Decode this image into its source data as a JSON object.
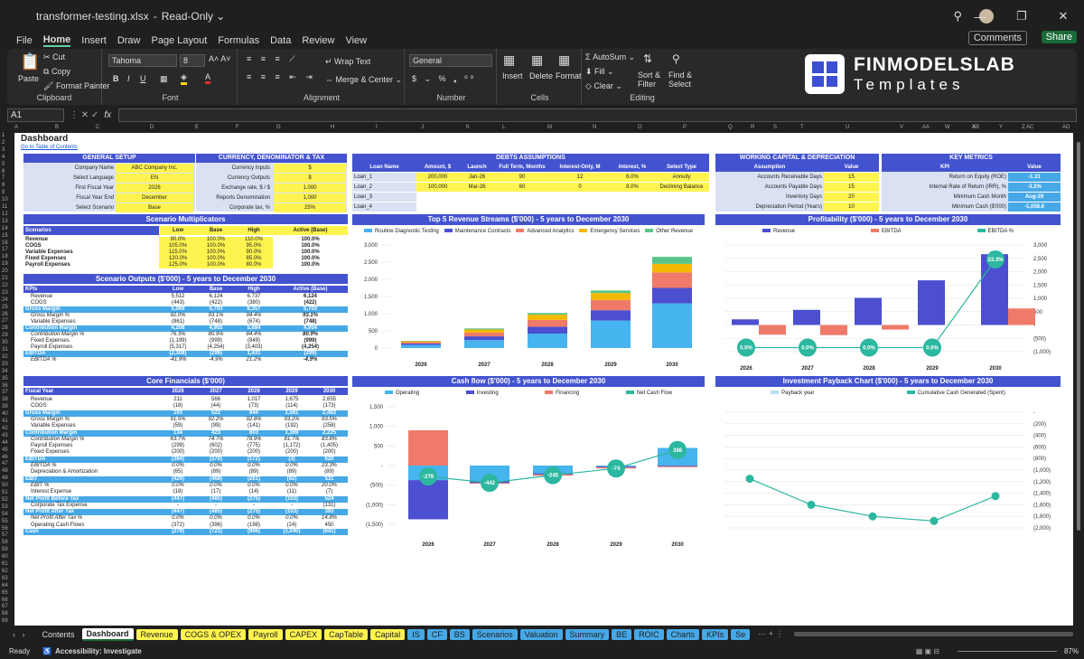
{
  "window": {
    "title": "transformer-testing.xlsx",
    "mode": "Read-Only"
  },
  "menu": [
    "File",
    "Home",
    "Insert",
    "Draw",
    "Page Layout",
    "Formulas",
    "Data",
    "Review",
    "View"
  ],
  "header_buttons": {
    "comments": "Comments",
    "share": "Share"
  },
  "ribbon": {
    "clipboard": {
      "paste": "Paste",
      "cut": "Cut",
      "copy": "Copy",
      "format_painter": "Format Painter",
      "label": "Clipboard"
    },
    "font": {
      "name": "Tahoma",
      "size": "8",
      "label": "Font"
    },
    "alignment": {
      "wrap": "Wrap Text",
      "merge": "Merge & Center",
      "label": "Alignment"
    },
    "number": {
      "format": "General",
      "label": "Number"
    },
    "cells": {
      "insert": "Insert",
      "delete": "Delete",
      "format": "Format",
      "label": "Cells"
    },
    "editing": {
      "autosum": "AutoSum",
      "fill": "Fill",
      "clear": "Clear",
      "sort": "Sort & Filter",
      "find": "Find & Select",
      "label": "Editing"
    },
    "logo": {
      "line1": "FINMODELSLAB",
      "line2": "Templates"
    }
  },
  "formula_bar": {
    "cell": "A1",
    "fx": "fx"
  },
  "columns": [
    "A",
    "B",
    "C",
    "D",
    "E",
    "F",
    "G",
    "H",
    "I",
    "J",
    "K",
    "L",
    "M",
    "N",
    "O",
    "P",
    "Q",
    "R",
    "S",
    "T",
    "U",
    "V",
    "W",
    "X",
    "Y",
    "Z",
    "AA",
    "AB",
    "AC",
    "AD"
  ],
  "dashboard": {
    "title": "Dashboard",
    "toc": "Go to Table of Contents",
    "general": {
      "title": "GENERAL SETUP",
      "rows": [
        [
          "Company Name",
          "ABC Company Inc."
        ],
        [
          "Select Language",
          "EN"
        ],
        [
          "First Fiscal Year",
          "2026"
        ],
        [
          "Fiscal Year End",
          "December"
        ],
        [
          "Select Scenario",
          "Base"
        ]
      ]
    },
    "currency": {
      "title": "CURRENCY, DENOMINATOR & TAX",
      "rows": [
        [
          "Currency Inputs",
          "$"
        ],
        [
          "Currency Outputs",
          "$"
        ],
        [
          "Exchange rate, $ / $",
          "1.000"
        ],
        [
          "Reports Denomination",
          "1,000"
        ],
        [
          "Corporate tax, %",
          "25%"
        ]
      ]
    },
    "debts": {
      "title": "DEBTS ASSUMPTIONS",
      "cols": [
        "Loan Name",
        "Amount, $",
        "Launch",
        "Full Term, Months",
        "Interest-Only, M",
        "Interest, %",
        "Select Type"
      ],
      "rows": [
        [
          "Loan_1",
          "200,000",
          "Jan-26",
          "90",
          "12",
          "6.0%",
          "Annuity"
        ],
        [
          "Loan_2",
          "100,000",
          "Mar-26",
          "60",
          "0",
          "8.0%",
          "Declining Balance"
        ],
        [
          "Loan_3",
          "",
          "",
          "",
          "",
          "",
          ""
        ],
        [
          "Loan_4",
          "",
          "",
          "",
          "",
          "",
          ""
        ]
      ]
    },
    "wc": {
      "title": "WORKING CAPITAL & DEPRECIATION",
      "cols": [
        "Assumption",
        "Value"
      ],
      "rows": [
        [
          "Accounts Receivable Days",
          "15"
        ],
        [
          "Accounts Payable Days",
          "15"
        ],
        [
          "Inventory Days",
          "20"
        ],
        [
          "Depreciation Period (Years)",
          "10"
        ]
      ]
    },
    "kpi": {
      "title": "KEY METRICS",
      "cols": [
        "KPI",
        "Value"
      ],
      "rows": [
        [
          "Return on Equity (ROE)",
          "-1.31"
        ],
        [
          "Internal Rate of Return (IRR), %",
          "-3.2%"
        ],
        [
          "Minimum Cash Month",
          "Aug-29"
        ],
        [
          "Minimum Cash ($'000)",
          "-1,058.6"
        ]
      ]
    },
    "scen_mult": {
      "title": "Scenario Multiplicators",
      "cols": [
        "Scenarios",
        "Low",
        "Base",
        "High",
        "Active (Base)"
      ],
      "rows": [
        [
          "Revenue",
          "90.0%",
          "100.0%",
          "110.0%",
          "100.0%"
        ],
        [
          "COGS",
          "105.0%",
          "100.0%",
          "95.0%",
          "100.0%"
        ],
        [
          "Variable Expenses",
          "115.0%",
          "100.0%",
          "90.0%",
          "100.0%"
        ],
        [
          "Fixed Expenses",
          "120.0%",
          "100.0%",
          "85.0%",
          "100.0%"
        ],
        [
          "Payroll Expenses",
          "125.0%",
          "100.0%",
          "80.0%",
          "100.0%"
        ]
      ]
    },
    "scen_out": {
      "title": "Scenario Outputs ($'000) - 5 years to December 2030",
      "cols": [
        "KPIs",
        "Low",
        "Base",
        "High",
        "Active (Base)"
      ],
      "rows": [
        [
          "Revenue",
          "5,512",
          "6,124",
          "6,737",
          "6,124",
          "n"
        ],
        [
          "COGS",
          "(443)",
          "(422)",
          "(380)",
          "(422)",
          "n"
        ],
        [
          "Gross Margin",
          "5,069",
          "5,703",
          "6,357",
          "5,703",
          "b"
        ],
        [
          "Gross Margin %",
          "92.0%",
          "93.1%",
          "94.4%",
          "93.1%",
          "i"
        ],
        [
          "Variable Expenses",
          "(861)",
          "(748)",
          "(674)",
          "(748)",
          "n"
        ],
        [
          "Contribution Margin",
          "4,208",
          "4,955",
          "5,684",
          "4,954",
          "b"
        ],
        [
          "Contribution Margin %",
          "76.3%",
          "80.9%",
          "84.4%",
          "80.9%",
          "i"
        ],
        [
          "Fixed Expenses",
          "(1,199)",
          "(999)",
          "(849)",
          "(999)",
          "n"
        ],
        [
          "Payroll Expenses",
          "(5,317)",
          "(4,254)",
          "(3,403)",
          "(4,254)",
          "n"
        ],
        [
          "EBITDA",
          "(2,308)",
          "(299)",
          "1,431",
          "(299)",
          "b"
        ],
        [
          "EBITDA %",
          "-41.9%",
          "-4.9%",
          "21.2%",
          "-4.9%",
          "i"
        ]
      ]
    },
    "core": {
      "title": "Core Financials ($'000)",
      "cols": [
        "Fiscal Year",
        "2026",
        "2027",
        "2028",
        "2029",
        "2030"
      ],
      "rows": [
        [
          "Revenue",
          "211",
          "566",
          "1,017",
          "1,675",
          "2,655",
          "n"
        ],
        [
          "COGS",
          "(18)",
          "(44)",
          "(73)",
          "(114)",
          "(173)",
          "n"
        ],
        [
          "Gross Margin",
          "193",
          "522",
          "944",
          "1,561",
          "2,483",
          "b"
        ],
        [
          "Gross Margin %",
          "91.5%",
          "92.2%",
          "92.8%",
          "93.2%",
          "93.5%",
          "i"
        ],
        [
          "Variable Expenses",
          "(59)",
          "(99)",
          "(141)",
          "(192)",
          "(258)",
          "n"
        ],
        [
          "Contribution Margin",
          "134",
          "423",
          "803",
          "1,369",
          "2,225",
          "b"
        ],
        [
          "Contribution Margin %",
          "63.7%",
          "74.7%",
          "78.9%",
          "81.7%",
          "83.8%",
          "i"
        ],
        [
          "Payroll Expenses",
          "(299)",
          "(602)",
          "(775)",
          "(1,172)",
          "(1,405)",
          "n"
        ],
        [
          "Fixed Expenses",
          "(200)",
          "(200)",
          "(200)",
          "(200)",
          "(200)",
          "n"
        ],
        [
          "EBITDA",
          "(364)",
          "(379)",
          "(172)",
          "(3)",
          "620",
          "b"
        ],
        [
          "EBITDA %",
          "0.0%",
          "0.0%",
          "0.0%",
          "0.0%",
          "23.3%",
          "i"
        ],
        [
          "Depreciation & Amortization",
          "(65)",
          "(89)",
          "(89)",
          "(89)",
          "(89)",
          "n"
        ],
        [
          "EBIT",
          "(429)",
          "(468)",
          "(261)",
          "(92)",
          "531",
          "b"
        ],
        [
          "EBIT %",
          "0.0%",
          "0.0%",
          "0.0%",
          "0.0%",
          "20.0%",
          "i"
        ],
        [
          "Interest Expense",
          "(18)",
          "(17)",
          "(14)",
          "(11)",
          "(7)",
          "n"
        ],
        [
          "Net Profit Before Tax",
          "(447)",
          "(485)",
          "(275)",
          "(103)",
          "524",
          "b"
        ],
        [
          "Corporate Tax Expense",
          "-",
          "-",
          "-",
          "-",
          "(131)",
          "n"
        ],
        [
          "Net Profit After Tax",
          "(447)",
          "(485)",
          "(275)",
          "(103)",
          "393",
          "b"
        ],
        [
          "Net Profit After Tax %",
          "0.0%",
          "0.0%",
          "0.0%",
          "0.0%",
          "14.8%",
          "i"
        ],
        [
          "Operating Cash Flows",
          "(372)",
          "(396)",
          "(198)",
          "(24)",
          "450",
          "n"
        ],
        [
          "Cash",
          "(279)",
          "(721)",
          "(966)",
          "(1,040)",
          "(641)",
          "b"
        ]
      ]
    }
  },
  "chart_data": [
    {
      "type": "bar",
      "title": "Top 5 Revenue Streams ($'000) - 5 years to December 2030",
      "categories": [
        "2026",
        "2027",
        "2028",
        "2029",
        "2030"
      ],
      "ylim": [
        0,
        3000
      ],
      "yticks": [
        "0",
        "500",
        "1,000",
        "1,500",
        "2,000",
        "2,500",
        "3,000"
      ],
      "series": [
        {
          "name": "Routine Diagnostic Testing",
          "color": "#46b4ee",
          "values": [
            90,
            230,
            420,
            800,
            1300
          ]
        },
        {
          "name": "Maintenance Contracts",
          "color": "#4b4fd0",
          "values": [
            40,
            110,
            200,
            300,
            450
          ]
        },
        {
          "name": "Advanced Analytics",
          "color": "#f07a6a",
          "values": [
            40,
            110,
            200,
            300,
            450
          ]
        },
        {
          "name": "Emergency Services",
          "color": "#f5b800",
          "values": [
            30,
            90,
            150,
            200,
            250
          ]
        },
        {
          "name": "Other Revenue",
          "color": "#59c58a",
          "values": [
            10,
            30,
            50,
            75,
            205
          ]
        }
      ]
    },
    {
      "type": "bar",
      "title": "Profitability ($'000) - 5 years to December 2030",
      "categories": [
        "2026",
        "2027",
        "2028",
        "2029",
        "2030"
      ],
      "ylim": [
        -1000,
        3000
      ],
      "yticks": [
        "(1,000)",
        "(500)",
        "-",
        "500",
        "1,000",
        "1,500",
        "2,000",
        "2,500",
        "3,000"
      ],
      "series": [
        {
          "name": "Revenue",
          "color": "#4b4fd0",
          "values": [
            211,
            566,
            1017,
            1675,
            2655
          ]
        },
        {
          "name": "EBITDA",
          "color": "#f07a6a",
          "values": [
            -364,
            -379,
            -172,
            -3,
            620
          ]
        },
        {
          "name": "EBITDA %",
          "color": "#2cb7a0",
          "values": [
            0,
            0,
            0,
            0,
            23.3
          ]
        }
      ],
      "point_labels": [
        "0.0%",
        "0.0%",
        "0.0%",
        "0.0%",
        "23.3%"
      ]
    },
    {
      "type": "bar",
      "title": "Cash flow ($'000) - 5 years to December 2030",
      "categories": [
        "2026",
        "2027",
        "2028",
        "2029",
        "2030"
      ],
      "ylim": [
        -1500,
        1500
      ],
      "yticks": [
        "(1,500)",
        "(1,000)",
        "(500)",
        "-",
        "500",
        "1,000",
        "1,500"
      ],
      "series": [
        {
          "name": "Operating",
          "color": "#46b4ee",
          "values": [
            -372,
            -396,
            -198,
            -24,
            450
          ]
        },
        {
          "name": "Investing",
          "color": "#4b4fd0",
          "values": [
            -1000,
            -50,
            -30,
            -20,
            -20
          ]
        },
        {
          "name": "Financing",
          "color": "#f07a6a",
          "values": [
            900,
            -20,
            -30,
            -30,
            -20
          ]
        },
        {
          "name": "Net Cash Flow",
          "color": "#2cb7a0",
          "values": [
            -279,
            -442,
            -245,
            -74,
            398
          ]
        }
      ],
      "point_labels": [
        "-279",
        "-442",
        "-245",
        "-74",
        "398"
      ]
    },
    {
      "type": "line",
      "title": "Investment Payback Chart ($'000) - 5 years to December 2030",
      "categories": [
        "2026",
        "2027",
        "2028",
        "2029",
        "2030"
      ],
      "ylim": [
        -2000,
        0
      ],
      "yticks": [
        "(2,000)",
        "(1,800)",
        "(1,600)",
        "(1,400)",
        "(1,200)",
        "(1,000)",
        "(800)",
        "(600)",
        "(400)",
        "(200)",
        "-"
      ],
      "series": [
        {
          "name": "Payback year",
          "color": "#b7dff7",
          "values": []
        },
        {
          "name": "Cumulative Cash Generated (Spent)",
          "color": "#2cb7a0",
          "values": [
            -1150,
            -1600,
            -1800,
            -1880,
            -1450
          ]
        }
      ]
    }
  ],
  "tabs": [
    "Contents",
    "Dashboard",
    "Revenue",
    "COGS & OPEX",
    "Payroll",
    "CAPEX",
    "CapTable",
    "Capital",
    "IS",
    "CF",
    "BS",
    "Scenarios",
    "Valuation",
    "Summary",
    "BE",
    "ROIC",
    "Charts",
    "KPIs",
    "Se"
  ],
  "tab_colors": [
    "#1f1f1f",
    "#ffffff",
    "#fff44f",
    "#fff44f",
    "#fff44f",
    "#fff44f",
    "#fff44f",
    "#fff44f",
    "#46a8e6",
    "#46a8e6",
    "#46a8e6",
    "#46a8e6",
    "#46a8e6",
    "#46a8e6",
    "#46a8e6",
    "#46a8e6",
    "#46a8e6",
    "#46a8e6",
    "#46a8e6"
  ],
  "status": {
    "ready": "Ready",
    "accessibility": "Accessibility: Investigate",
    "zoom": "87%"
  }
}
